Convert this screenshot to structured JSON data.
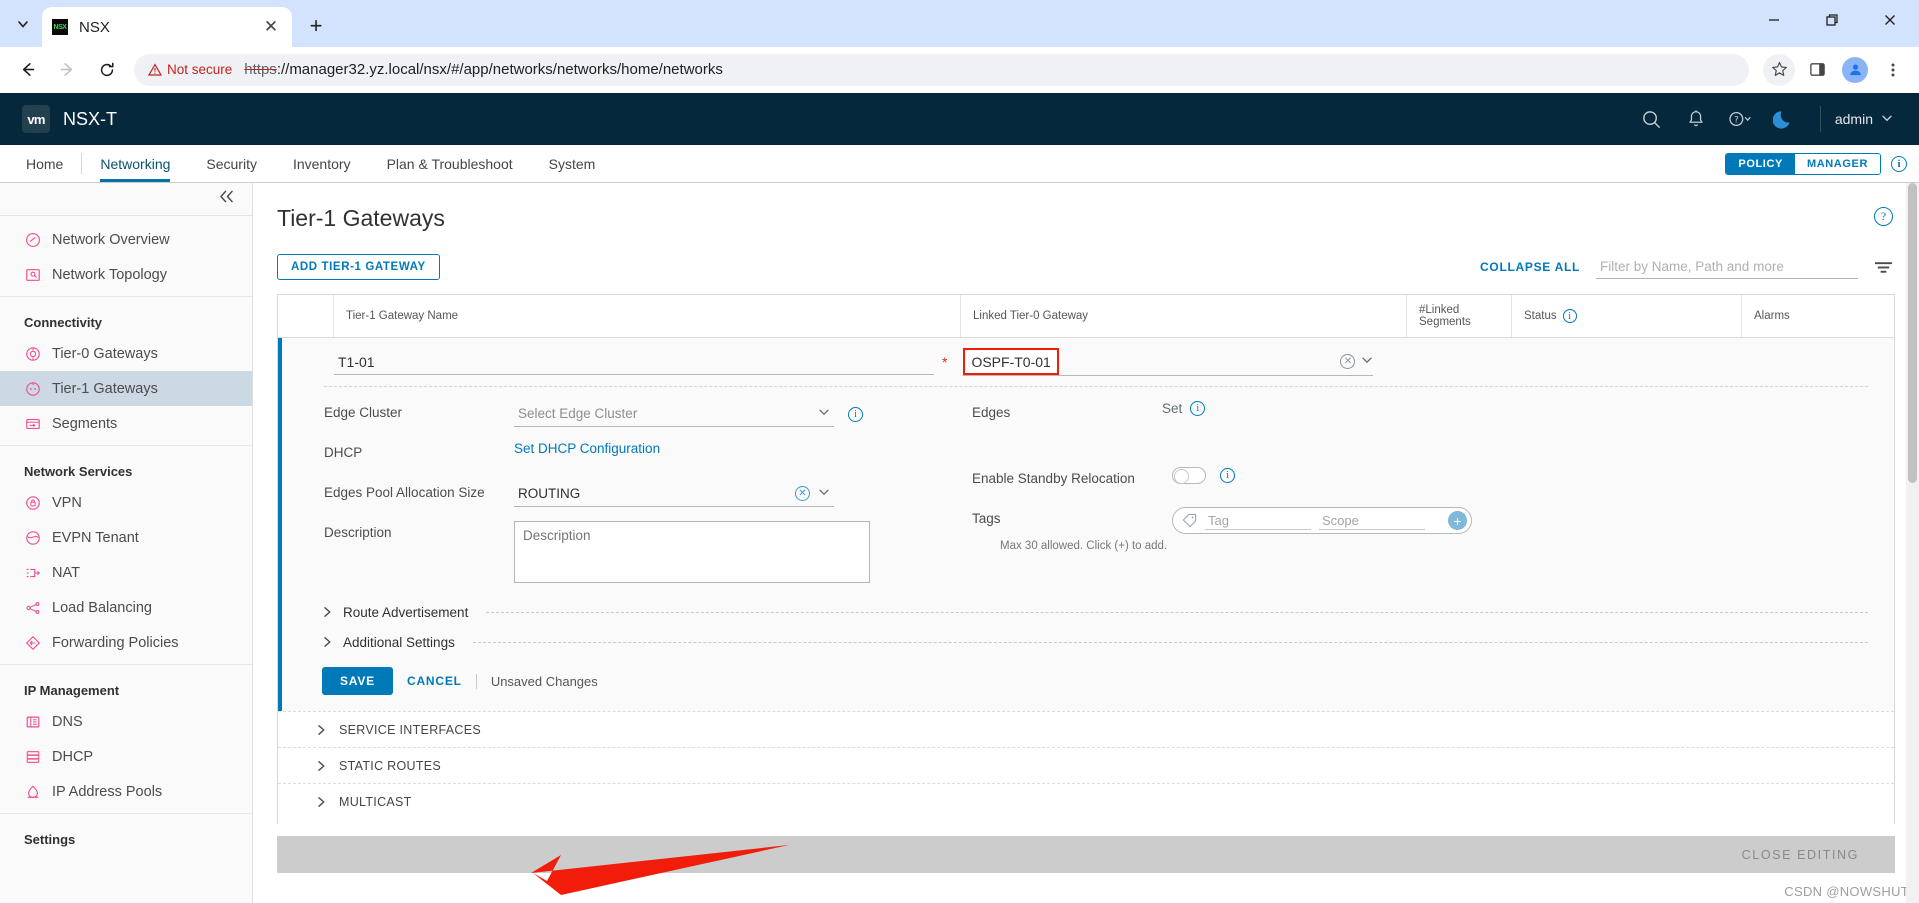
{
  "browser": {
    "tab": {
      "title": "NSX",
      "favicon_label": "NSX",
      "favicon_icon": "nsx-favicon"
    },
    "new_tab_icon": "plus-icon",
    "tab_list_icon": "chevron-down-icon",
    "close_tab_icon": "close-icon",
    "window": {
      "minimize": "minimize-icon",
      "maximize": "restore-icon",
      "close": "close-icon"
    },
    "nav": {
      "back": "back-arrow-icon",
      "forward": "forward-arrow-icon",
      "reload": "reload-icon"
    },
    "security_label": "Not secure",
    "url_scheme": "https",
    "url_rest": "://manager32.yz.local/nsx/#/app/networks/networks/home/networks",
    "toolbar_icons": [
      "bookmark-star-icon",
      "side-panel-icon",
      "profile-avatar-icon",
      "chrome-menu-icon"
    ]
  },
  "app_header": {
    "logo_text": "vm",
    "product": "NSX-T",
    "icons": [
      "search-icon",
      "bell-icon",
      "help-icon",
      "dark-mode-moon-icon"
    ],
    "user": "admin",
    "user_chevron": "chevron-down-icon"
  },
  "navbar": {
    "items": [
      {
        "label": "Home",
        "active": false
      },
      {
        "label": "Networking",
        "active": true
      },
      {
        "label": "Security",
        "active": false
      },
      {
        "label": "Inventory",
        "active": false
      },
      {
        "label": "Plan & Troubleshoot",
        "active": false
      },
      {
        "label": "System",
        "active": false
      }
    ],
    "mode_toggle": {
      "policy": "POLICY",
      "manager": "MANAGER",
      "active": "POLICY"
    },
    "info_icon": "info-icon"
  },
  "sidebar": {
    "collapse_icon": "double-chevron-left-icon",
    "groups": [
      {
        "heading": null,
        "items": [
          {
            "label": "Network Overview",
            "icon": "gauge-icon",
            "selected": false
          },
          {
            "label": "Network Topology",
            "icon": "topology-icon",
            "selected": false
          }
        ]
      },
      {
        "heading": "Connectivity",
        "items": [
          {
            "label": "Tier-0 Gateways",
            "icon": "tier0-icon",
            "selected": false
          },
          {
            "label": "Tier-1 Gateways",
            "icon": "tier1-icon",
            "selected": true
          },
          {
            "label": "Segments",
            "icon": "segments-icon",
            "selected": false
          }
        ]
      },
      {
        "heading": "Network Services",
        "items": [
          {
            "label": "VPN",
            "icon": "vpn-lock-icon",
            "selected": false
          },
          {
            "label": "EVPN Tenant",
            "icon": "evpn-icon",
            "selected": false
          },
          {
            "label": "NAT",
            "icon": "nat-icon",
            "selected": false
          },
          {
            "label": "Load Balancing",
            "icon": "load-balancing-icon",
            "selected": false
          },
          {
            "label": "Forwarding Policies",
            "icon": "forwarding-icon",
            "selected": false
          }
        ]
      },
      {
        "heading": "IP Management",
        "items": [
          {
            "label": "DNS",
            "icon": "dns-icon",
            "selected": false
          },
          {
            "label": "DHCP",
            "icon": "dhcp-icon",
            "selected": false
          },
          {
            "label": "IP Address Pools",
            "icon": "ip-pools-icon",
            "selected": false
          }
        ]
      },
      {
        "heading": "Settings",
        "items": []
      }
    ]
  },
  "main": {
    "page_title": "Tier-1 Gateways",
    "help_icon": "help-circle-icon",
    "add_button": "ADD TIER-1 GATEWAY",
    "collapse_all": "COLLAPSE ALL",
    "filter_placeholder": "Filter by Name, Path and more",
    "filter_value": "",
    "filter_icon": "filter-icon",
    "columns": [
      {
        "label": "",
        "key": "select"
      },
      {
        "label": "Tier-1 Gateway Name",
        "key": "name"
      },
      {
        "label": "Linked Tier-0 Gateway",
        "key": "linked_t0"
      },
      {
        "label": "#Linked Segments",
        "key": "linked_segments"
      },
      {
        "label": "Status",
        "key": "status",
        "info_icon": "info-icon"
      },
      {
        "label": "Alarms",
        "key": "alarms"
      }
    ],
    "row": {
      "name_value": "T1-01",
      "name_required_marker": "*",
      "linked_t0_value": "OSPF-T0-01",
      "linked_t0_clear_icon": "clear-x-icon",
      "linked_t0_chevron": "chevron-down-icon",
      "highlight_color": "#f21c0a",
      "fields_left": [
        {
          "label": "Edge Cluster",
          "type": "select",
          "value": "",
          "placeholder": "Select Edge Cluster",
          "info": true
        },
        {
          "label": "DHCP",
          "type": "link",
          "value": "Set DHCP Configuration"
        },
        {
          "label": "Edges Pool Allocation Size",
          "type": "select-clear",
          "value": "ROUTING",
          "info": false
        },
        {
          "label": "Description",
          "type": "textarea",
          "value": "",
          "placeholder": "Description"
        }
      ],
      "fields_right": [
        {
          "label": "Edges",
          "type": "text-info",
          "value": "Set",
          "info": true
        },
        {
          "label": "Enable Standby Relocation",
          "type": "toggle",
          "value": "off",
          "info": true
        },
        {
          "label": "Tags",
          "type": "tags",
          "tag_placeholder": "Tag",
          "scope_placeholder": "Scope",
          "add_icon": "plus-circle-icon"
        }
      ],
      "tags_hint": "Max 30 allowed. Click (+) to add.",
      "accordions": [
        {
          "label": "Route Advertisement",
          "icon": "chevron-right-icon"
        },
        {
          "label": "Additional Settings",
          "icon": "chevron-right-icon"
        }
      ],
      "save_button": "SAVE",
      "cancel_button": "CANCEL",
      "unsaved_text": "Unsaved Changes"
    },
    "sections": [
      {
        "label": "SERVICE INTERFACES",
        "icon": "chevron-right-icon"
      },
      {
        "label": "STATIC ROUTES",
        "icon": "chevron-right-icon"
      },
      {
        "label": "MULTICAST",
        "icon": "chevron-right-icon"
      }
    ],
    "footer_button": "CLOSE EDITING",
    "watermark": "CSDN @NOWSHUT"
  }
}
